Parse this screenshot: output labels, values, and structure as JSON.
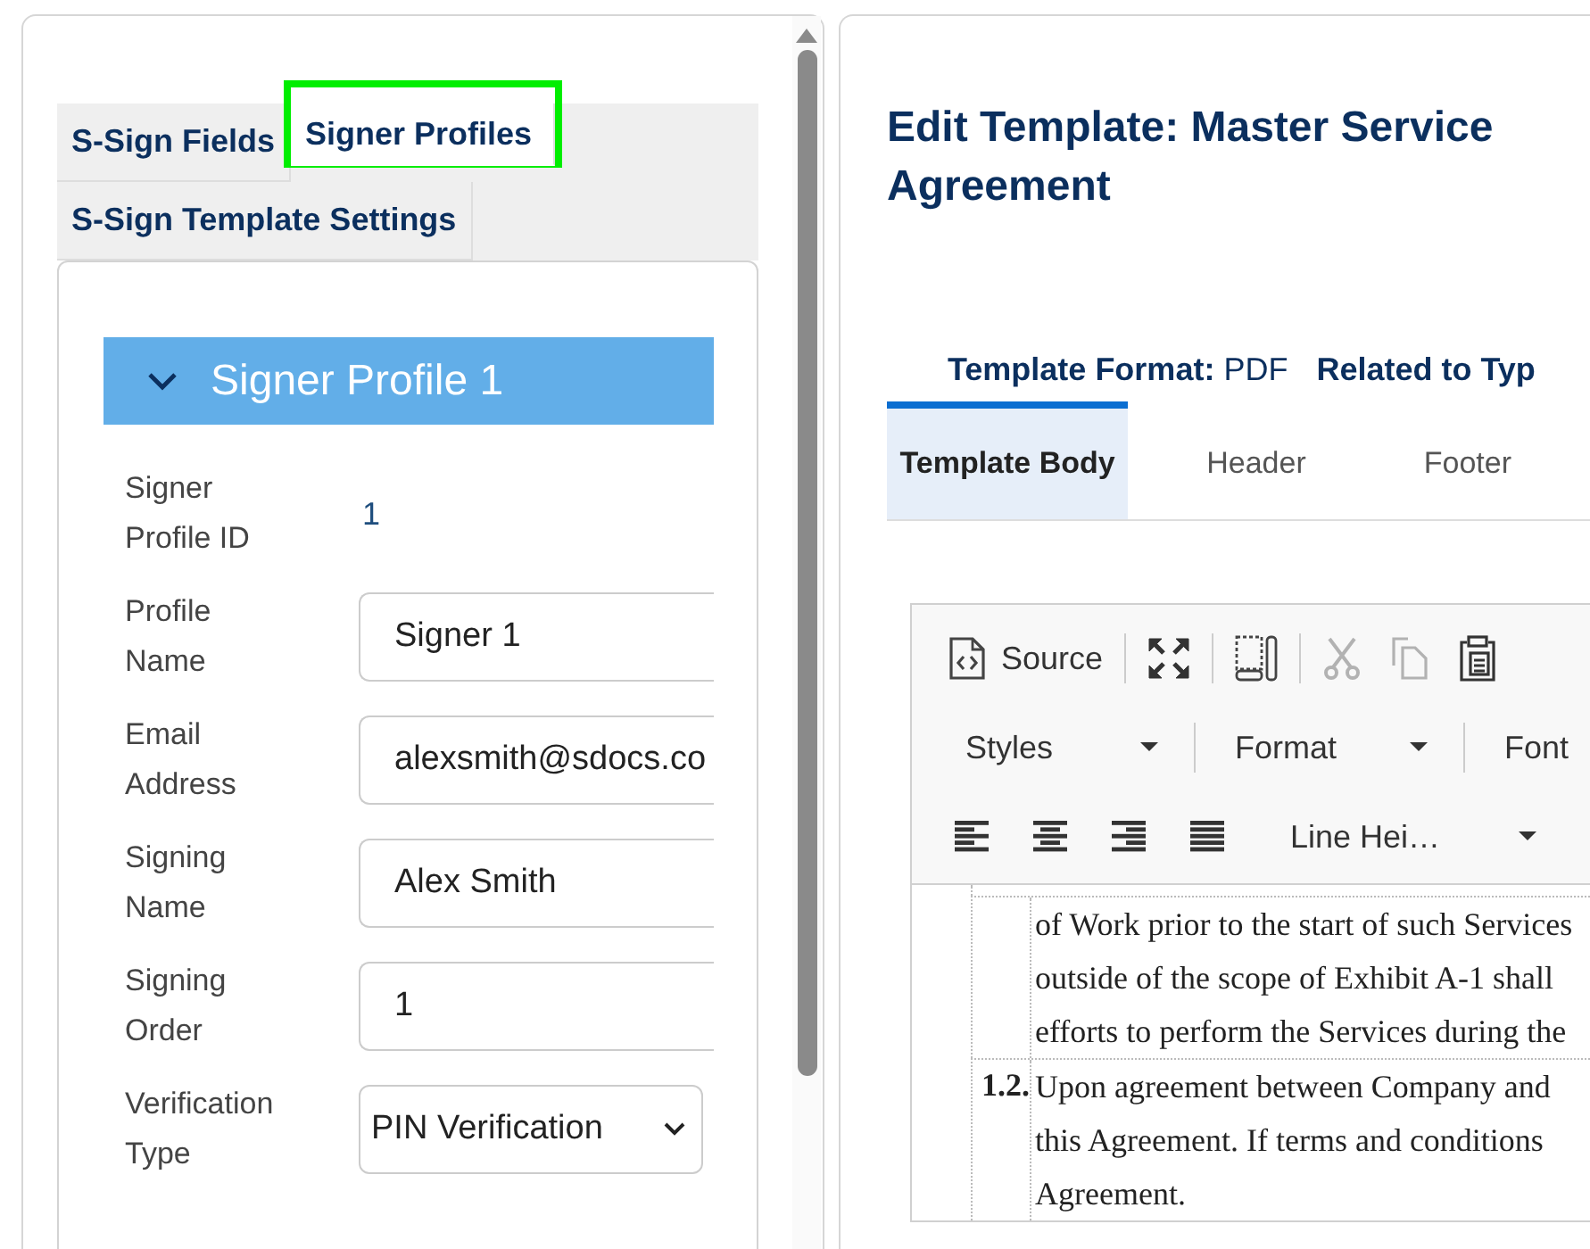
{
  "left_panel": {
    "tabs": [
      {
        "label": "S-Sign Fields",
        "selected": false,
        "highlighted": false
      },
      {
        "label": "Signer Profiles",
        "selected": true,
        "highlighted": true
      },
      {
        "label": "S-Sign Template Settings",
        "selected": false,
        "highlighted": false
      }
    ],
    "profile": {
      "title": "Signer Profile 1",
      "expanded": true,
      "fields": [
        {
          "label": "Signer Profile ID",
          "kind": "static",
          "value": "1"
        },
        {
          "label": "Profile Name",
          "kind": "input",
          "value": "Signer 1"
        },
        {
          "label": "Email Address",
          "kind": "input",
          "value": "alexsmith@sdocs.co"
        },
        {
          "label": "Signing Name",
          "kind": "input",
          "value": "Alex Smith"
        },
        {
          "label": "Signing Order",
          "kind": "input",
          "value": "1"
        },
        {
          "label": "Verification Type",
          "kind": "select",
          "value": "PIN Verification"
        }
      ]
    }
  },
  "editor_panel": {
    "title": "Edit Template: Master Service Agreement",
    "meta": [
      {
        "label": "Template Format:",
        "value": "PDF"
      },
      {
        "label": "Related to Typ"
      }
    ],
    "tabs": [
      {
        "label": "Template Body",
        "selected": true
      },
      {
        "label": "Header",
        "selected": false
      },
      {
        "label": "Footer",
        "selected": false
      }
    ],
    "toolbar": {
      "source": "Source",
      "cut_disabled": true,
      "copy_disabled": true,
      "dropdowns": [
        {
          "label": "Styles"
        },
        {
          "label": "Format"
        },
        {
          "label": "Font"
        }
      ],
      "line_height": "Line Hei…"
    },
    "document": [
      {
        "lines": [
          "of Work prior to the start of such Services",
          "outside of the scope of Exhibit A-1 shall",
          "efforts to perform the Services during the"
        ]
      },
      {
        "number": "1.2.",
        "lines": [
          "Upon agreement between Company and",
          "this Agreement. If terms and conditions",
          "Agreement."
        ]
      }
    ]
  }
}
